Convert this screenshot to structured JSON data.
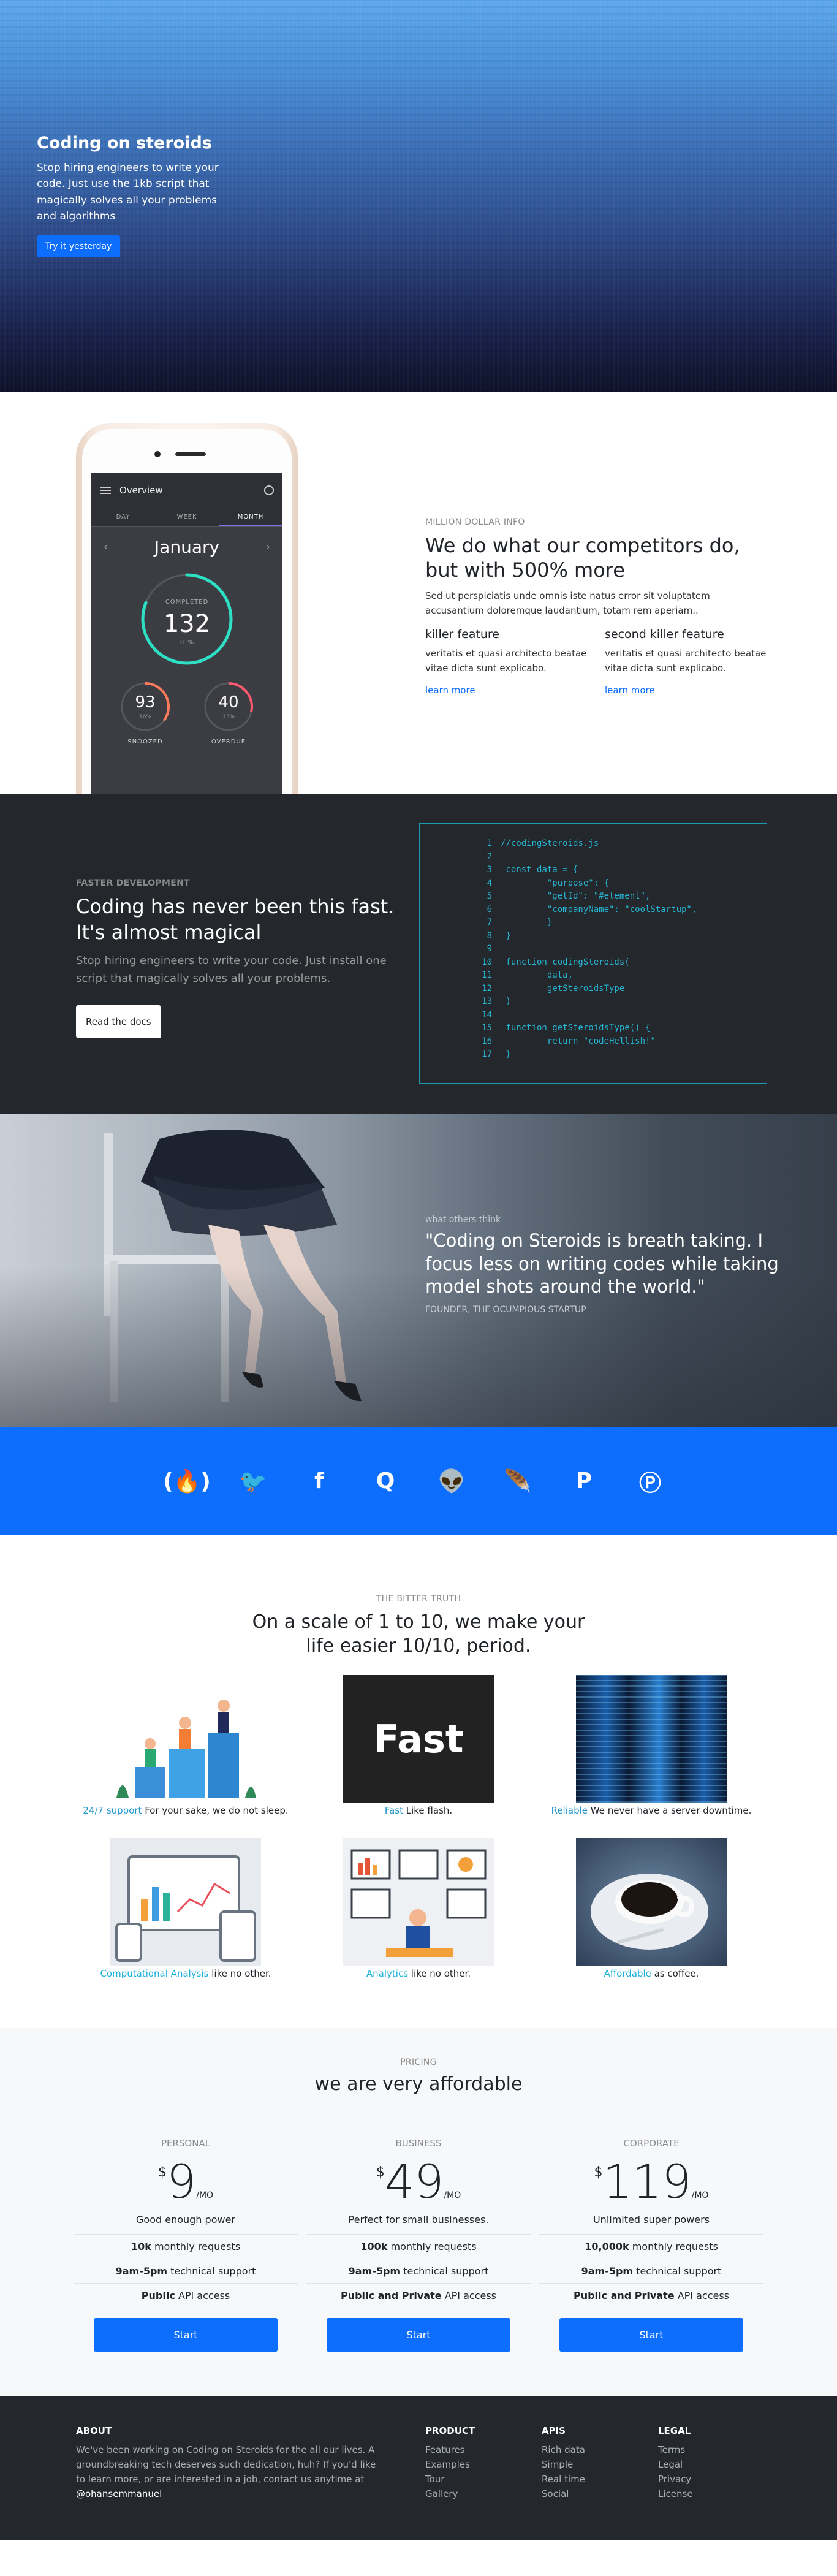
{
  "hero": {
    "title": "Coding on steroids",
    "text": "Stop hiring engineers to write your code. Just use the 1kb script that magically solves all your problems and algorithms",
    "cta": "Try it yesterday"
  },
  "phone_app": {
    "title": "Overview",
    "tabs": [
      "DAY",
      "WEEK",
      "MONTH"
    ],
    "month": "January",
    "completed_label": "COMPLETED",
    "completed_value": "132",
    "completed_pct": "81%",
    "dials": [
      {
        "value": "93",
        "pct": "16%",
        "label": "SNOOZED",
        "color": "#ff7b5c"
      },
      {
        "value": "40",
        "pct": "13%",
        "label": "OVERDUE",
        "color": "#ff5a6e"
      }
    ]
  },
  "feature": {
    "eyebrow": "MILLION DOLLAR INFO",
    "title": "We do what our competitors do, but with 500% more",
    "subtitle": "Sed ut perspiciatis unde omnis iste natus error sit voluptatem accusantium doloremque laudantium, totam rem aperiam..",
    "items": [
      {
        "title": "killer feature",
        "text": "veritatis et quasi architecto beatae vitae dicta sunt explicabo.",
        "link": "learn more"
      },
      {
        "title": "second killer feature",
        "text": "veritatis et quasi architecto beatae vitae dicta sunt explicabo.",
        "link": "learn more"
      }
    ]
  },
  "dev": {
    "eyebrow": "FASTER DEVELOPMENT",
    "title": "Coding has never been this fast. It's almost magical",
    "text": "Stop hiring engineers to write your code. Just install one script that magically solves all your problems.",
    "cta": "Read the docs",
    "code": [
      {
        "n": "1",
        "t": "//codingSteroids.js"
      },
      {
        "n": "2",
        "t": ""
      },
      {
        "n": "3",
        "t": " const data = {"
      },
      {
        "n": "4",
        "t": "         \"purpose\": {"
      },
      {
        "n": "5",
        "t": "         \"getId\": \"#element\","
      },
      {
        "n": "6",
        "t": "         \"companyName\": \"coolStartup\","
      },
      {
        "n": "7",
        "t": "         }"
      },
      {
        "n": "8",
        "t": " }"
      },
      {
        "n": "9",
        "t": ""
      },
      {
        "n": "10",
        "t": " function codingSteroids("
      },
      {
        "n": "11",
        "t": "         data,"
      },
      {
        "n": "12",
        "t": "         getSteroidsType"
      },
      {
        "n": "13",
        "t": " )"
      },
      {
        "n": "14",
        "t": ""
      },
      {
        "n": "15",
        "t": " function getSteroidsType() {"
      },
      {
        "n": "16",
        "t": "         return \"codeHellish!\""
      },
      {
        "n": "17",
        "t": " }"
      }
    ]
  },
  "testimonial": {
    "eyebrow": "what others think",
    "quote": "\"Coding on Steroids is breath taking. I focus less on writing codes while taking model shots around the world.\"",
    "source": "FOUNDER, THE OCUMPIOUS STARTUP"
  },
  "social": [
    {
      "icon": "freecodecamp-icon",
      "glyph": "(🔥)"
    },
    {
      "icon": "twitter-icon",
      "glyph": "🐦"
    },
    {
      "icon": "facebook-icon",
      "glyph": "f"
    },
    {
      "icon": "quora-icon",
      "glyph": "Q"
    },
    {
      "icon": "reddit-icon",
      "glyph": "👽"
    },
    {
      "icon": "feather-icon",
      "glyph": "🪶"
    },
    {
      "icon": "paypal-icon",
      "glyph": "P"
    },
    {
      "icon": "producthunt-icon",
      "glyph": "Ⓟ"
    }
  ],
  "bitter": {
    "eyebrow": "THE BITTER TRUTH",
    "title": "On a scale of 1 to 10, we make your life easier 10/10, period.",
    "items": [
      {
        "highlight": "24/7 support",
        "text": " For your sake, we do not sleep."
      },
      {
        "highlight": "Fast",
        "text": " Like flash.",
        "image_text": "Fast"
      },
      {
        "highlight": "Reliable",
        "text": " We never have a server downtime."
      },
      {
        "highlight": "Computational Analysis",
        "text": " like no other."
      },
      {
        "highlight": "Analytics",
        "text": " like no other."
      },
      {
        "highlight": "Affordable",
        "text": " as coffee."
      }
    ]
  },
  "pricing": {
    "eyebrow": "PRICING",
    "title": "we are very affordable",
    "plans": [
      {
        "name": "PERSONAL",
        "currency": "$",
        "amount": "9",
        "per": "/MO",
        "tagline": "Good enough power",
        "rows": [
          {
            "b": "10k",
            "t": " monthly requests"
          },
          {
            "b": "9am-5pm",
            "t": " technical support"
          },
          {
            "b": "Public",
            "t": " API access"
          }
        ],
        "cta": "Start"
      },
      {
        "name": "BUSINESS",
        "currency": "$",
        "amount": "49",
        "per": "/MO",
        "tagline": "Perfect for small businesses.",
        "rows": [
          {
            "b": "100k",
            "t": " monthly requests"
          },
          {
            "b": "9am-5pm",
            "t": " technical support"
          },
          {
            "b": "Public and Private",
            "t": " API access"
          }
        ],
        "cta": "Start"
      },
      {
        "name": "CORPORATE",
        "currency": "$",
        "amount": "119",
        "per": "/MO",
        "tagline": "Unlimited super powers",
        "rows": [
          {
            "b": "10,000k",
            "t": " monthly requests"
          },
          {
            "b": "9am-5pm",
            "t": " technical support"
          },
          {
            "b": "Public and Private",
            "t": " API access"
          }
        ],
        "cta": "Start"
      }
    ]
  },
  "footer": {
    "about_title": "ABOUT",
    "about_text": "We've been working on Coding on Steroids for the all our lives. A groundbreaking tech deserves such dedication, huh? If you'd like to learn more, or are interested in a job, contact us anytime at ",
    "about_handle": "@ohansemmanuel",
    "columns": [
      {
        "title": "PRODUCT",
        "links": [
          "Features",
          "Examples",
          "Tour",
          "Gallery"
        ]
      },
      {
        "title": "APIS",
        "links": [
          "Rich data",
          "Simple",
          "Real time",
          "Social"
        ]
      },
      {
        "title": "LEGAL",
        "links": [
          "Terms",
          "Legal",
          "Privacy",
          "License"
        ]
      }
    ]
  }
}
